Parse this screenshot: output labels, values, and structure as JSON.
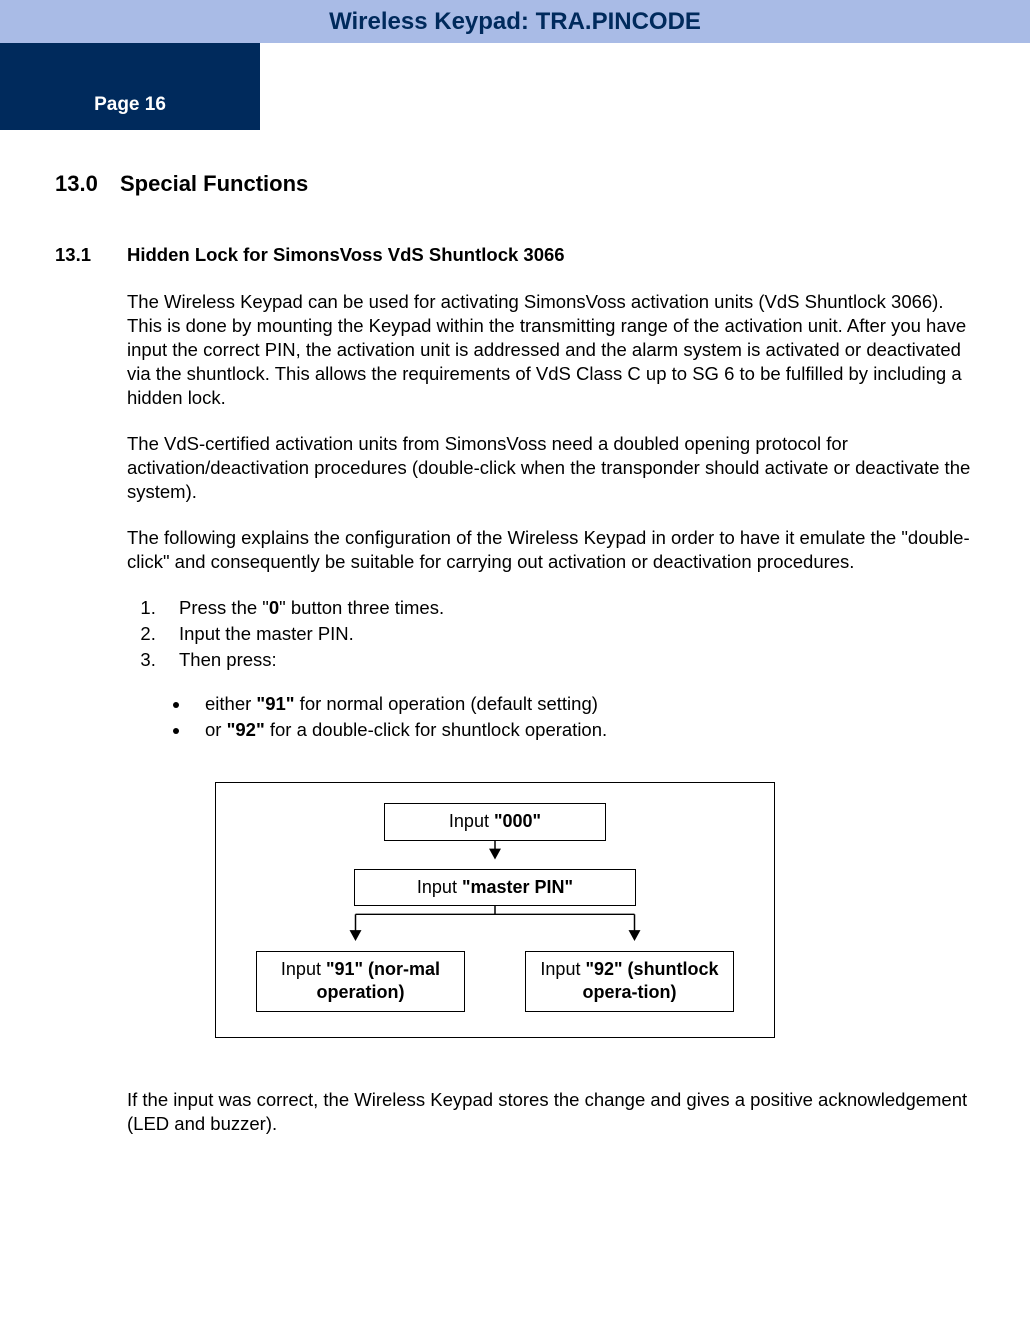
{
  "header": {
    "title": "Wireless Keypad: TRA.PINCODE",
    "page_label": "Page 16"
  },
  "section": {
    "number": "13.0",
    "title": "Special Functions"
  },
  "subsection": {
    "number": "13.1",
    "title": "Hidden Lock for SimonsVoss VdS Shuntlock 3066"
  },
  "para1": "The Wireless Keypad can be used for activating SimonsVoss activation units (VdS Shuntlock 3066). This is done by mounting the Keypad within the transmitting range of the activation unit. After you have input the correct PIN, the activation unit is addressed and the alarm system is activated or deactivated via the shuntlock. This allows the requirements of VdS Class C up to SG 6 to be fulfilled by including a hidden lock.",
  "para2": "The VdS-certified activation units from SimonsVoss need a doubled opening protocol for activation/deactivation procedures (double-click when the transponder should activate or deactivate the system).",
  "para3": "The following explains the configuration of the Wireless Keypad in order to have it emulate the \"double-click\" and consequently be suitable for carrying out activation or deactivation procedures.",
  "steps": {
    "s1a": "Press the \"",
    "s1b": "0",
    "s1c": "\" button three times.",
    "s2": "Input the master PIN.",
    "s3": "Then press:"
  },
  "bullets": {
    "b1a": "either ",
    "b1b": "\"91\"",
    "b1c": " for normal operation (default setting)",
    "b2a": "or ",
    "b2b": "\"92\"",
    "b2c": "  for a double-click for shuntlock operation."
  },
  "diagram": {
    "box1a": "Input ",
    "box1b": "\"000\"",
    "box2a": "Input ",
    "box2b": "\"master PIN\"",
    "box3a": "Input ",
    "box3b": "\"91\" (nor-mal operation)",
    "box4a": "Input ",
    "box4b": "\"92\" (shuntlock opera-tion)"
  },
  "para4": "If the input was correct, the Wireless Keypad stores the change and gives a positive acknowledgement (LED and buzzer)."
}
